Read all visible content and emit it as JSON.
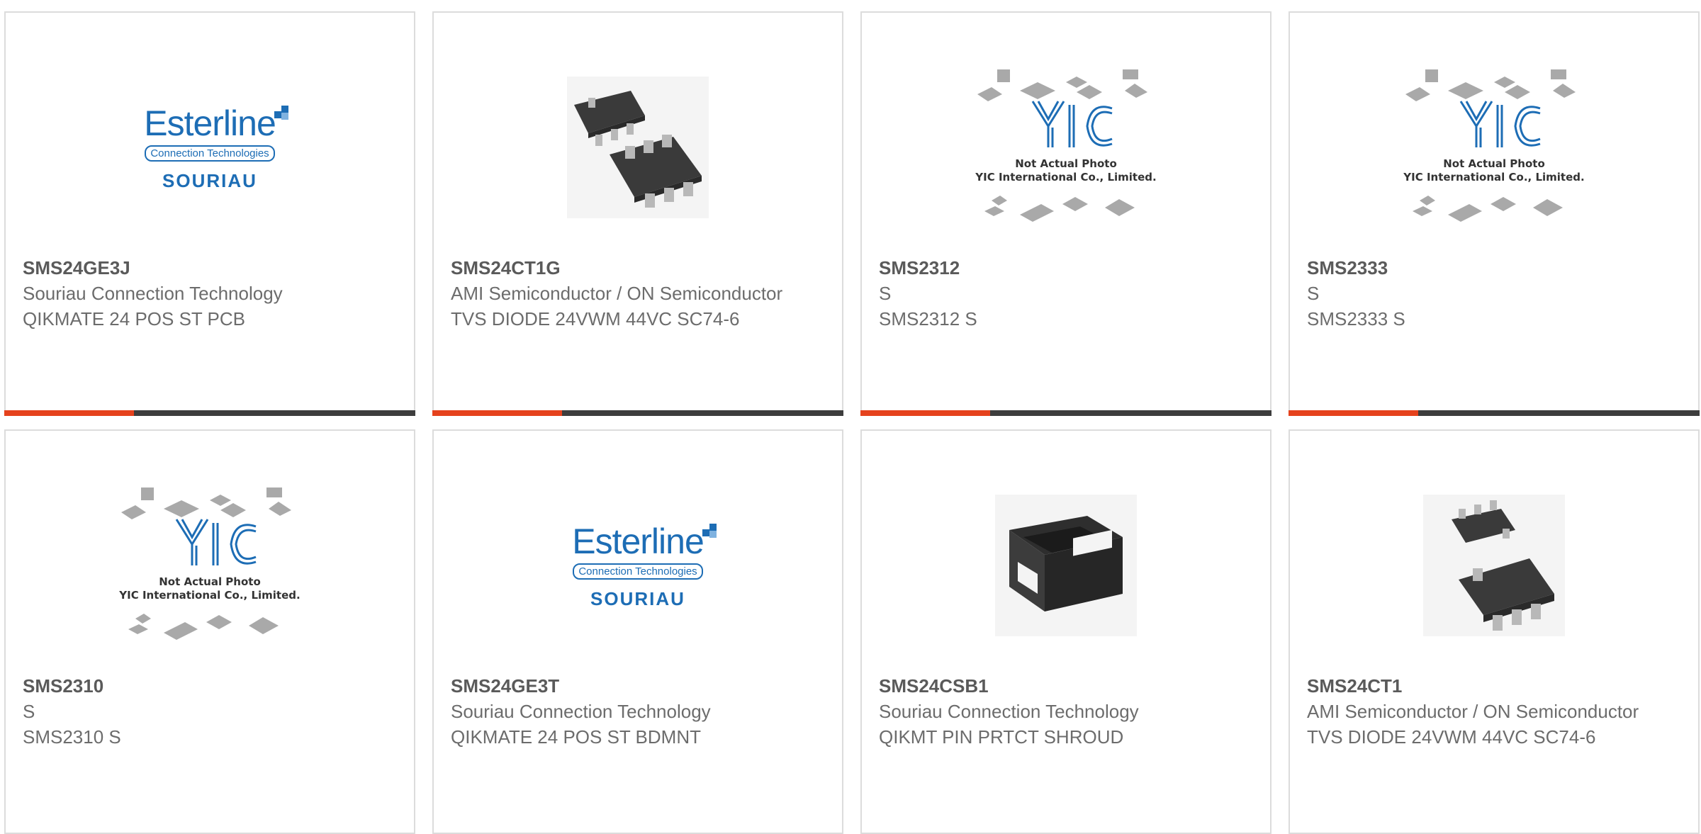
{
  "colors": {
    "accent": "#e5421d",
    "bar": "#3d3d3d",
    "border": "#dcdcdc",
    "part_number": "#5a5a5a",
    "text": "#6c6c6c",
    "brand_blue": "#1d6db5"
  },
  "products": [
    {
      "part_number": "SMS24GE3J",
      "manufacturer": "Souriau Connection Technology",
      "description": "QIKMATE 24 POS ST PCB",
      "image": "esterline-souriau-logo",
      "logo": {
        "brand": "Esterline",
        "sub": "Connection Technologies",
        "name": "SOURIAU"
      }
    },
    {
      "part_number": "SMS24CT1G",
      "manufacturer": "AMI Semiconductor / ON Semiconductor",
      "description": "TVS DIODE 24VWM 44VC SC74-6",
      "image": "sc74-chip-photo"
    },
    {
      "part_number": "SMS2312",
      "manufacturer": "S",
      "description": "SMS2312 S",
      "image": "yic-placeholder",
      "logo": {
        "name": "YIC",
        "line1": "Not Actual Photo",
        "line2": "YIC International Co., Limited."
      }
    },
    {
      "part_number": "SMS2333",
      "manufacturer": "S",
      "description": "SMS2333 S",
      "image": "yic-placeholder",
      "logo": {
        "name": "YIC",
        "line1": "Not Actual Photo",
        "line2": "YIC International Co., Limited."
      }
    },
    {
      "part_number": "SMS2310",
      "manufacturer": "S",
      "description": "SMS2310 S",
      "image": "yic-placeholder",
      "logo": {
        "name": "YIC",
        "line1": "Not Actual Photo",
        "line2": "YIC International Co., Limited."
      }
    },
    {
      "part_number": "SMS24GE3T",
      "manufacturer": "Souriau Connection Technology",
      "description": "QIKMATE 24 POS ST BDMNT",
      "image": "esterline-souriau-logo",
      "logo": {
        "brand": "Esterline",
        "sub": "Connection Technologies",
        "name": "SOURIAU"
      }
    },
    {
      "part_number": "SMS24CSB1",
      "manufacturer": "Souriau Connection Technology",
      "description": "QIKMT PIN PRTCT SHROUD",
      "image": "shroud-photo"
    },
    {
      "part_number": "SMS24CT1",
      "manufacturer": "AMI Semiconductor / ON Semiconductor",
      "description": "TVS DIODE 24VWM 44VC SC74-6",
      "image": "sc74-chip-photo"
    }
  ]
}
